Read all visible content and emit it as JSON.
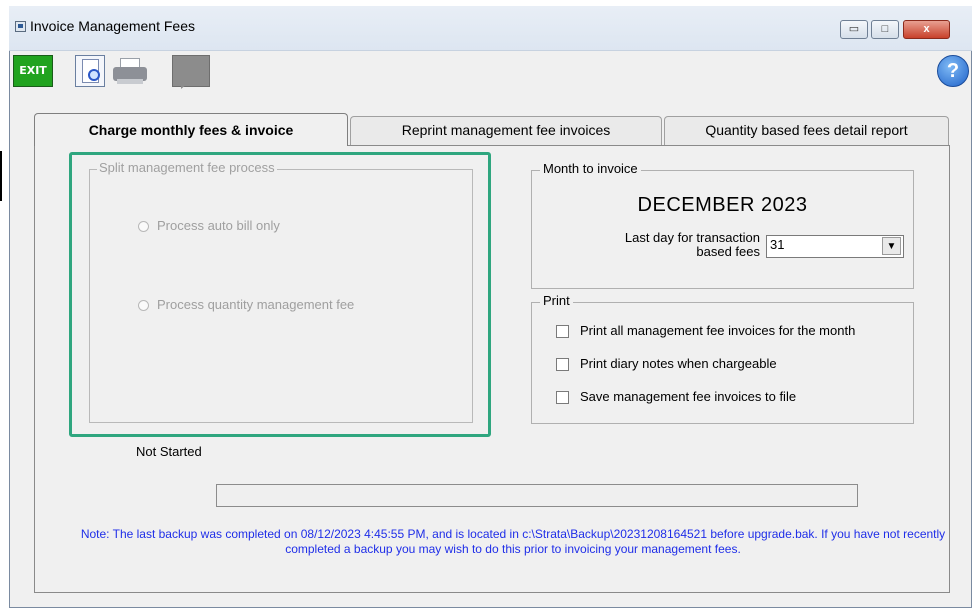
{
  "window": {
    "title": "Invoice Management Fees",
    "controls": {
      "minimize": "▭",
      "maximize": "□",
      "close": "x"
    }
  },
  "toolbar": {
    "exit_label": "EXIT",
    "help_label": "?"
  },
  "tabs": [
    {
      "label": "Charge monthly fees & invoice",
      "active": true
    },
    {
      "label": "Reprint management fee invoices",
      "active": false
    },
    {
      "label": "Quantity based fees detail report",
      "active": false
    }
  ],
  "split_group": {
    "legend": "Split management fee process",
    "enabled": false,
    "options": [
      {
        "label": "Process auto bill only"
      },
      {
        "label": "Process quantity management fee"
      }
    ]
  },
  "month_group": {
    "legend": "Month to invoice",
    "month": "DECEMBER 2023",
    "last_day_label": "Last day for transaction based fees",
    "last_day_value": "31"
  },
  "print_group": {
    "legend": "Print",
    "options": [
      {
        "label": "Print all management fee invoices for the month",
        "checked": false
      },
      {
        "label": "Print diary notes when chargeable",
        "checked": false
      },
      {
        "label": "Save management fee invoices to file",
        "checked": false
      }
    ]
  },
  "status": "Not Started",
  "progress": 0,
  "note": "Note: The last backup was completed on 08/12/2023 4:45:55 PM, and is located in c:\\Strata\\Backup\\20231208164521 before upgrade.bak. If you have not recently completed a backup you may wish to do this prior to invoicing your management fees.",
  "colors": {
    "highlight": "#2fa67f",
    "note_text": "#1f2ee8",
    "exit_button": "#21a31f"
  }
}
